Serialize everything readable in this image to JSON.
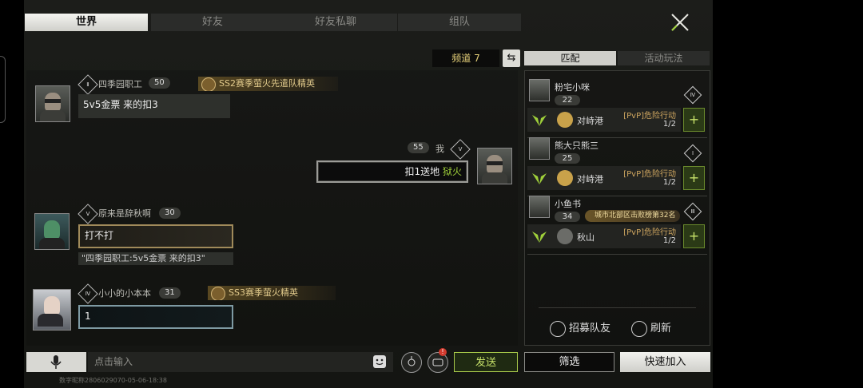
{
  "tabs": [
    {
      "label": "世界",
      "active": true
    },
    {
      "label": "好友",
      "active": false
    },
    {
      "label": "好友私聊",
      "active": false
    },
    {
      "label": "组队",
      "active": false
    }
  ],
  "channel": {
    "label": "频道 7"
  },
  "messages": [
    {
      "rank": "Ⅱ",
      "name": "四季园职工",
      "level": "50",
      "title": "SS2赛季萤火先遣队精英",
      "text": "5v5金票 来的扣3"
    },
    {
      "rank": "Ⅴ",
      "name": "我",
      "level": "55",
      "text": "扣1送地",
      "highlight": "狱火"
    },
    {
      "rank": "Ⅴ",
      "name": "原来是辞秋啊",
      "level": "30",
      "text": "打不打",
      "quote": "\"四季园职工:5v5金票 来的扣3\""
    },
    {
      "rank": "Ⅳ",
      "name": "小小的小本本",
      "level": "31",
      "title": "SS3赛季萤火精英",
      "text": "1"
    }
  ],
  "input": {
    "placeholder": "点击输入",
    "send_label": "发送",
    "notify_badge": "!"
  },
  "footer": "数字昵称2806029070-05-06-18:38",
  "right_tabs": [
    {
      "label": "匹配",
      "active": true
    },
    {
      "label": "活动玩法",
      "active": false
    }
  ],
  "teams": [
    {
      "name": "粉宅小咪",
      "level": "22",
      "rank": "Ⅳ",
      "map": "对峙港",
      "mode": "[PvP]危险行动",
      "count": "1/2",
      "map_icon": "house"
    },
    {
      "name": "熊大只熊三",
      "level": "25",
      "rank": "Ⅰ",
      "map": "对峙港",
      "mode": "[PvP]危险行动",
      "count": "1/2",
      "map_icon": "house"
    },
    {
      "name": "小鱼书",
      "level": "34",
      "rank": "Ⅲ",
      "badge": "城市北部区击败榜第32名",
      "map": "秋山",
      "mode": "[PvP]危险行动",
      "count": "1/2",
      "map_icon": "mountain"
    }
  ],
  "actions": {
    "recruit": "招募队友",
    "refresh": "刷新",
    "filter": "筛选",
    "quick_join": "快速加入",
    "plus": "+"
  },
  "colors": {
    "accent_green": "#c8e36a",
    "gold": "#e3cc8d",
    "bg": "#1a1b18"
  }
}
